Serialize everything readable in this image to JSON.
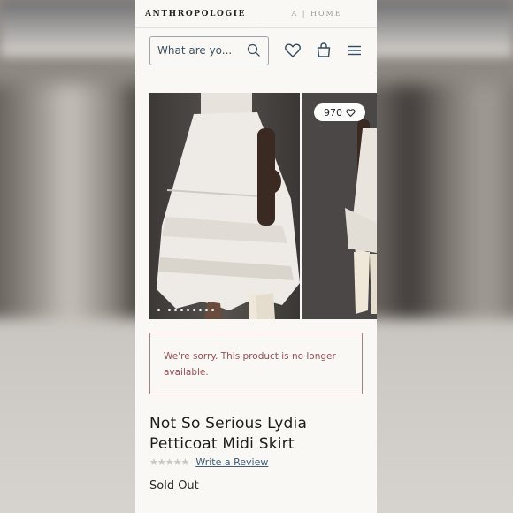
{
  "header": {
    "brand": "ANTHROPOLOGIE",
    "home_tab": "A | HOME"
  },
  "search": {
    "placeholder": "What are yo..."
  },
  "icons": {
    "search": "search-icon",
    "wishlist": "heart-icon",
    "bag": "shopping-bag-icon",
    "menu": "hamburger-menu-icon"
  },
  "gallery": {
    "favorite_count": "970",
    "dot_count": 9,
    "active_dot": 0
  },
  "alert": {
    "message": "We're sorry. This product is no longer available."
  },
  "product": {
    "title": "Not So Serious Lydia Petticoat Midi Skirt",
    "stars": "★★★★★",
    "review_link": "Write a Review",
    "status": "Sold Out"
  },
  "colors": {
    "alert_text": "#9c4d53",
    "alert_border": "#a57d83",
    "link": "#3f5d7a",
    "accent": "#3f5466"
  }
}
